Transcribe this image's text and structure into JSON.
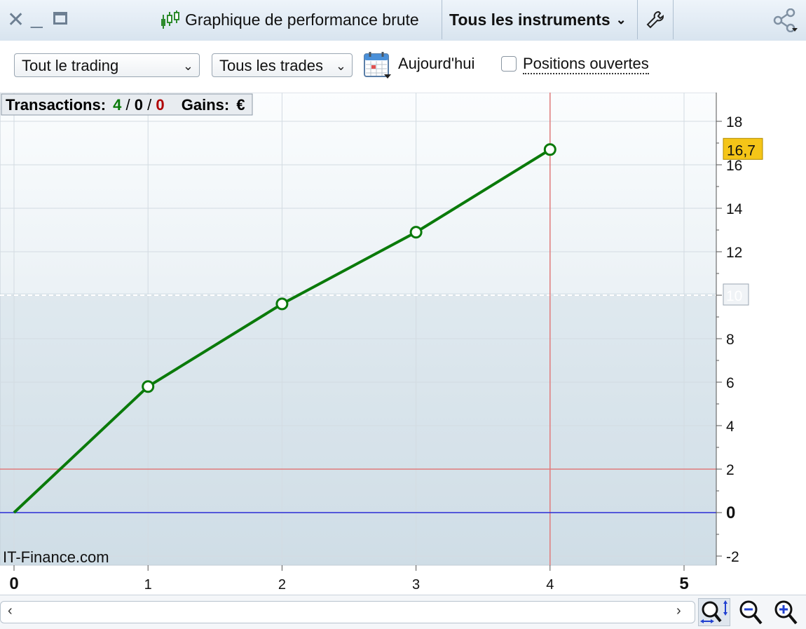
{
  "window": {
    "title": "Graphique de performance brute",
    "instruments_label": "Tous les instruments"
  },
  "toolbar": {
    "trading_select": "Tout le trading",
    "trades_select": "Tous les trades",
    "date_label": "Aujourd'hui",
    "open_positions_label": "Positions ouvertes"
  },
  "stats": {
    "transactions_label": "Transactions:",
    "t_win": "4",
    "t_sep1": " / ",
    "t_zero": "0",
    "t_sep2": " / ",
    "t_loss": "0",
    "gains_label": "Gains:",
    "gains_value": "€"
  },
  "watermark": "IT-Finance.com",
  "colors": {
    "line": "#0a7a0a",
    "win": "#0a7a0a",
    "loss": "#b00000",
    "zero_line": "#2b2bd6",
    "ref_line": "#e07a7a",
    "value_badge": "#f5c518"
  },
  "chart_data": {
    "type": "line",
    "x": [
      0,
      1,
      2,
      3,
      4
    ],
    "series": [
      {
        "values": [
          0,
          5.8,
          9.6,
          12.9,
          16.7
        ]
      }
    ],
    "xlim": [
      0,
      5.2
    ],
    "ylim": [
      -2.5,
      19
    ],
    "x_ticks": [
      "0",
      "1",
      "2",
      "3",
      "4",
      "5"
    ],
    "y_ticks": [
      "18",
      "16",
      "14",
      "12",
      "8",
      "6",
      "4",
      "2",
      "0",
      "-2"
    ],
    "y_tick_values": [
      18,
      16,
      14,
      12,
      8,
      6,
      4,
      2,
      0,
      -2
    ],
    "last_value_label": "16,7",
    "reference_label": "10",
    "reference_value": 10,
    "horizontal_lines": [
      2
    ],
    "vertical_lines": [
      4
    ],
    "grid": true
  }
}
